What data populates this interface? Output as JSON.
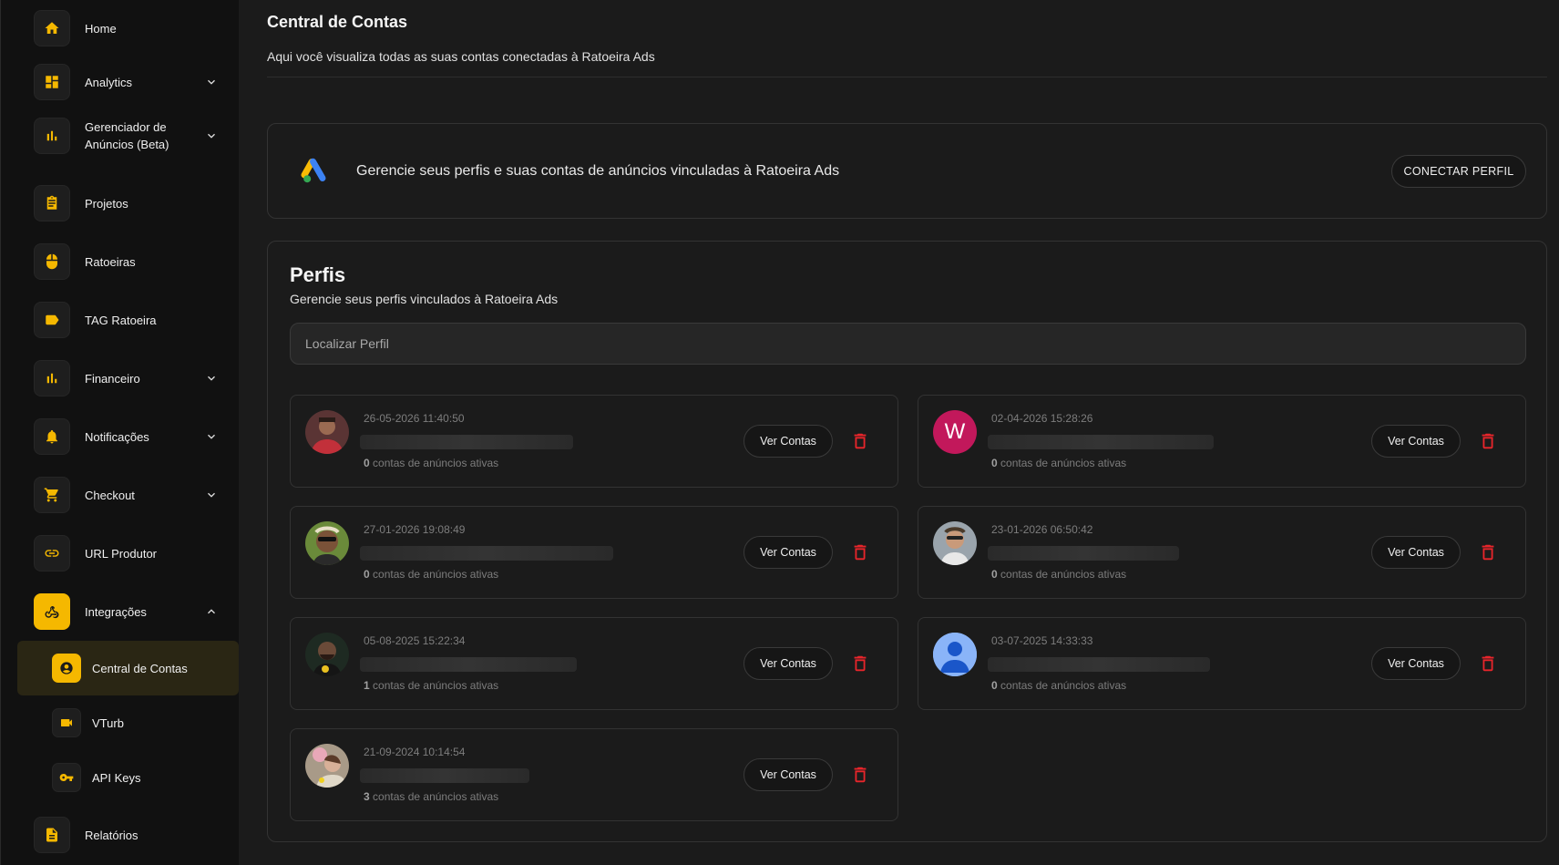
{
  "sidebar": {
    "items": [
      {
        "label": "Home",
        "icon": "home-icon"
      },
      {
        "label": "Analytics",
        "icon": "dashboard-icon",
        "expandable": true
      },
      {
        "label": "Gerenciador de Anúncios (Beta)",
        "icon": "bar-chart-icon",
        "expandable": true
      },
      {
        "label": "Projetos",
        "icon": "clipboard-icon"
      },
      {
        "label": "Ratoeiras",
        "icon": "mouse-icon"
      },
      {
        "label": "TAG Ratoeira",
        "icon": "label-icon"
      },
      {
        "label": "Financeiro",
        "icon": "bar-chart-icon",
        "expandable": true
      },
      {
        "label": "Notificações",
        "icon": "bell-icon",
        "expandable": true
      },
      {
        "label": "Checkout",
        "icon": "cart-icon",
        "expandable": true
      },
      {
        "label": "URL Produtor",
        "icon": "link-icon"
      },
      {
        "label": "Integrações",
        "icon": "webhook-icon",
        "expanded": true
      },
      {
        "label": "Relatórios",
        "icon": "document-icon"
      }
    ],
    "sub_items": [
      {
        "label": "Central de Contas",
        "icon": "account-circle-icon",
        "selected": true
      },
      {
        "label": "VTurb",
        "icon": "video-icon"
      },
      {
        "label": "API Keys",
        "icon": "key-icon"
      }
    ]
  },
  "header": {
    "title": "Central de Contas",
    "subtitle": "Aqui você visualiza todas as suas contas conectadas à Ratoeira Ads"
  },
  "connect": {
    "text": "Gerencie seus perfis e suas contas de anúncios vinculadas à Ratoeira Ads",
    "button_label": "CONECTAR PERFIL",
    "logo": "google-ads-logo"
  },
  "perfis": {
    "title": "Perfis",
    "subtitle": "Gerencie seus perfis vinculados à Ratoeira Ads",
    "search_placeholder": "Localizar Perfil",
    "ver_contas_label": "Ver Contas",
    "count_suffix": "contas de anúncios ativas",
    "profiles": [
      {
        "date": "26-05-2026 11:40:50",
        "count": "0",
        "avatar": "photo-avatar"
      },
      {
        "date": "02-04-2026 15:28:26",
        "count": "0",
        "avatar": "letter-avatar",
        "letter": "W"
      },
      {
        "date": "27-01-2026 19:08:49",
        "count": "0",
        "avatar": "photo-avatar"
      },
      {
        "date": "23-01-2026 06:50:42",
        "count": "0",
        "avatar": "photo-avatar"
      },
      {
        "date": "05-08-2025 15:22:34",
        "count": "1",
        "avatar": "photo-avatar"
      },
      {
        "date": "03-07-2025 14:33:33",
        "count": "0",
        "avatar": "default-user-avatar"
      },
      {
        "date": "21-09-2024 10:14:54",
        "count": "3",
        "avatar": "photo-avatar"
      }
    ]
  },
  "colors": {
    "accent": "#f5b800",
    "danger": "#e8252b",
    "background": "#1b1b1b",
    "sidebar": "#111111"
  }
}
